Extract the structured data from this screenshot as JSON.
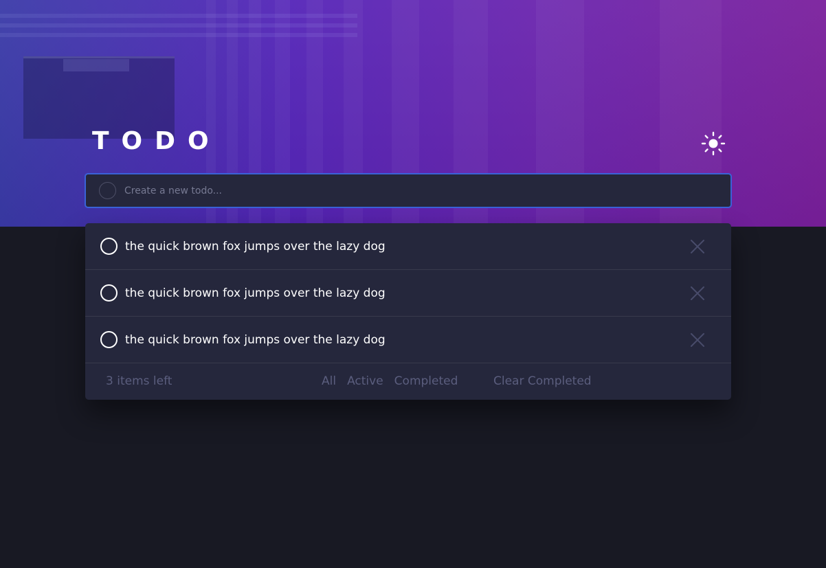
{
  "header": {
    "title": "TODO",
    "theme_icon": "sun-icon"
  },
  "new_todo": {
    "placeholder": "Create a new todo..."
  },
  "todos": [
    {
      "text": "the quick brown fox jumps over the lazy dog",
      "completed": false
    },
    {
      "text": "the quick brown fox jumps over the lazy dog",
      "completed": false
    },
    {
      "text": "the quick brown fox jumps over the lazy dog",
      "completed": false
    }
  ],
  "footer": {
    "items_left": "3 items left",
    "filters": [
      "All",
      "Active",
      "Completed"
    ],
    "clear_label": "Clear Completed"
  },
  "colors": {
    "accent_border": "#3a62d8",
    "panel": "#25273c",
    "page_bg": "#181923",
    "muted_text": "#5b5e7e"
  }
}
